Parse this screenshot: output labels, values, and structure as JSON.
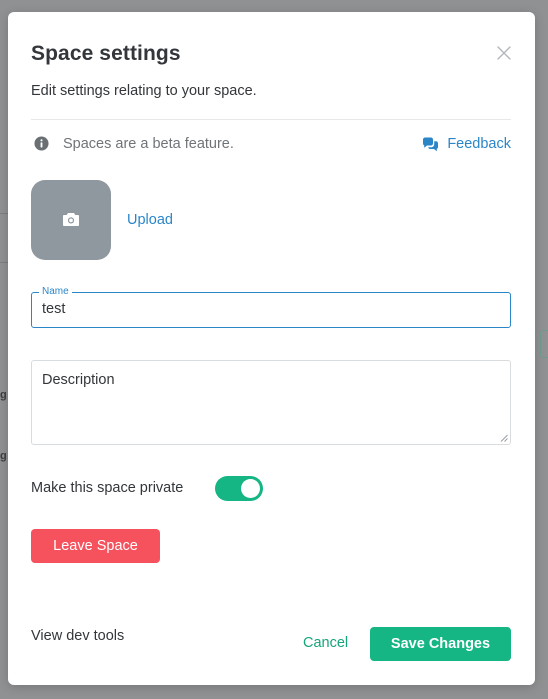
{
  "background": {
    "fragments": [
      "g",
      "g"
    ]
  },
  "modal": {
    "title": "Space settings",
    "subtitle": "Edit settings relating to your space.",
    "close_icon": "close-icon",
    "beta_notice": "Spaces are a beta feature.",
    "feedback_label": "Feedback",
    "upload_label": "Upload",
    "name_field": {
      "label": "Name",
      "value": "test"
    },
    "description_field": {
      "placeholder": "Description",
      "value": ""
    },
    "private_label": "Make this space private",
    "private_enabled": true,
    "leave_button_label": "Leave Space",
    "dev_tools_label": "View dev tools",
    "cancel_label": "Cancel",
    "save_label": "Save Changes"
  },
  "colors": {
    "accent_blue": "#2b86c8",
    "accent_green": "#15b584",
    "danger_red": "#f5525d",
    "avatar_gray": "#8f989f"
  }
}
